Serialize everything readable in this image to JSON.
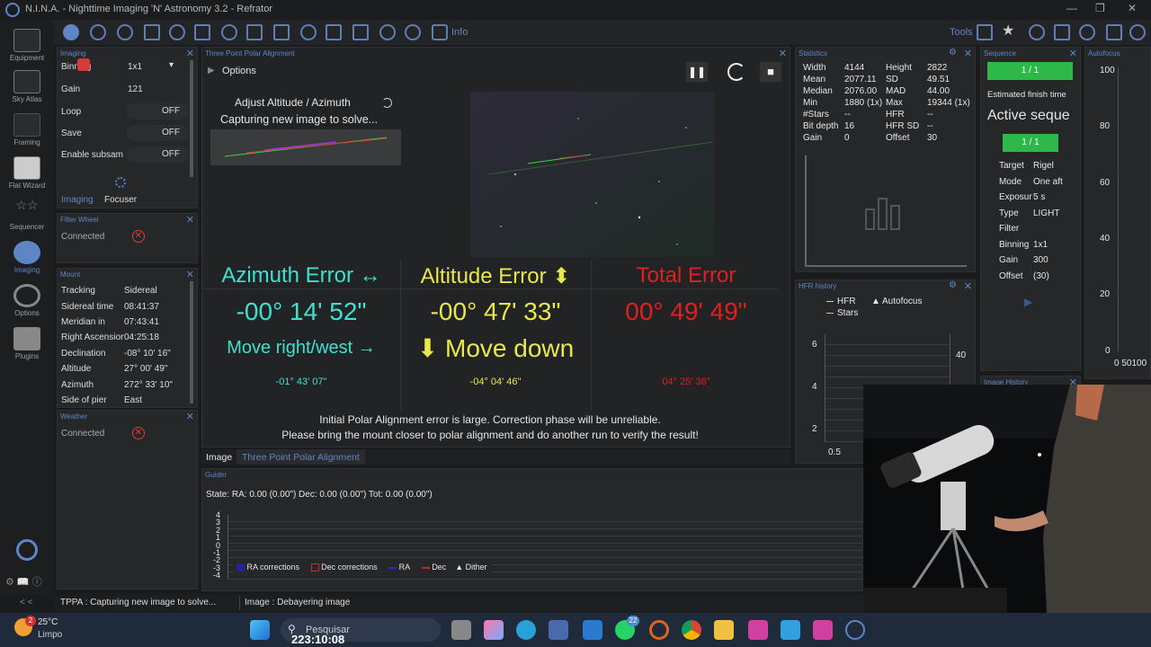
{
  "window": {
    "title": "N.I.N.A. - Nighttime Imaging 'N' Astronomy 3.2 - Refrator",
    "minimize": "—",
    "restore": "❐",
    "close": "✕"
  },
  "sidebar": {
    "items": [
      {
        "label": "Equipment"
      },
      {
        "label": "Sky Atlas"
      },
      {
        "label": "Framing"
      },
      {
        "label": "Flat Wizard"
      },
      {
        "label": "Sequencer"
      },
      {
        "label": "Imaging"
      },
      {
        "label": "Options"
      },
      {
        "label": "Plugins"
      }
    ],
    "collapse": "< <"
  },
  "toolbar": {
    "info": "Info",
    "tools": "Tools"
  },
  "imaging_panel": {
    "header": "Imaging",
    "binning_label": "Binning",
    "binning_value": "1x1",
    "gain_label": "Gain",
    "gain_value": "121",
    "loop_label": "Loop",
    "loop_value": "OFF",
    "save_label": "Save",
    "save_value": "OFF",
    "subsample_label": "Enable subsam",
    "subsample_value": "OFF",
    "tab_imaging": "Imaging",
    "tab_focuser": "Focuser"
  },
  "filterwheel": {
    "header": "Filter Wheel",
    "connected": "Connected"
  },
  "mount": {
    "header": "Mount",
    "rows": [
      {
        "label": "Tracking",
        "value": "Sidereal"
      },
      {
        "label": "Sidereal time",
        "value": "08:41:37"
      },
      {
        "label": "Meridian in",
        "value": "07:43:41"
      },
      {
        "label": "Right Ascension",
        "value": "04:25:18"
      },
      {
        "label": "Declination",
        "value": "-08° 10' 16\""
      },
      {
        "label": "Altitude",
        "value": "27° 00' 49\""
      },
      {
        "label": "Azimuth",
        "value": "272° 33' 10\""
      },
      {
        "label": "Side of pier",
        "value": "East"
      }
    ]
  },
  "weather": {
    "header": "Weather",
    "connected": "Connected"
  },
  "tppa": {
    "header": "Three Point Polar Alignment",
    "options": "Options",
    "adjust": "Adjust Altitude / Azimuth",
    "capturing": "Capturing new image to solve...",
    "az_title": "Azimuth Error ↔",
    "alt_title": "Altitude Error ⬍",
    "total_title": "Total Error",
    "az_value": "-00° 14' 52\"",
    "alt_value": "-00° 47' 33\"",
    "total_value": "00° 49' 49\"",
    "az_move": "Move right/west →",
    "alt_move": "⬇ Move down",
    "az_small": "-01° 43' 07\"",
    "alt_small": "-04° 04' 46\"",
    "total_small": "04° 25' 36\"",
    "warning1": "Initial Polar Alignment error is large. Correction phase will be unreliable.",
    "warning2": "Please bring the mount closer to polar alignment and do another run to verify the result!",
    "tab_image": "Image",
    "tab_tppa": "Three Point Polar Alignment",
    "colors": {
      "az": "#3fe0d0",
      "alt": "#e8e84a",
      "total": "#e02020"
    }
  },
  "statistics": {
    "header": "Statistics",
    "rows": [
      [
        "Width",
        "4144",
        "Height",
        "2822"
      ],
      [
        "Mean",
        "2077.11",
        "SD",
        "49.51"
      ],
      [
        "Median",
        "2076.00",
        "MAD",
        "44.00"
      ],
      [
        "Min",
        "1880 (1x)",
        "Max",
        "19344 (1x)"
      ],
      [
        "#Stars",
        "--",
        "HFR",
        "--"
      ],
      [
        "Bit depth",
        "16",
        "HFR SD",
        "--"
      ],
      [
        "Gain",
        "0",
        "Offset",
        "30"
      ]
    ]
  },
  "hfr": {
    "header": "HFR history",
    "legend_hfr": "HFR",
    "legend_af": "Autofocus",
    "legend_stars": "Stars",
    "y_ticks": [
      "6",
      "4",
      "2"
    ],
    "y_right": "40",
    "x_tick": "0.5"
  },
  "sequence": {
    "header": "Sequence",
    "progress1": "1 / 1",
    "estimated": "Estimated finish time",
    "active": "Active seque",
    "progress2": "1 / 1",
    "rows": [
      {
        "label": "Target",
        "value": "Rigel"
      },
      {
        "label": "Mode",
        "value": "One aft"
      },
      {
        "label": "Exposur",
        "value": "5 s"
      },
      {
        "label": "Type",
        "value": "LIGHT"
      },
      {
        "label": "Filter",
        "value": ""
      },
      {
        "label": "Binning",
        "value": "1x1"
      },
      {
        "label": "Gain",
        "value": "300"
      },
      {
        "label": "Offset",
        "value": "(30)"
      }
    ],
    "history": "Image History"
  },
  "autofocus": {
    "header": "Autofocus",
    "ticks": [
      "100",
      "80",
      "60",
      "40",
      "20",
      "0"
    ],
    "x": "0 50100"
  },
  "guider": {
    "header": "Guider",
    "state": "State:  RA: 0.00 (0.00\")  Dec: 0.00 (0.00\")  Tot: 0.00 (0.00\")",
    "y_ticks": [
      "4",
      "3",
      "2",
      "1",
      "0",
      "-1",
      "-2",
      "-3",
      "-4"
    ],
    "legend": [
      "RA corrections",
      "Dec corrections",
      "RA",
      "Dec",
      "Dither"
    ]
  },
  "status": {
    "tppa": "TPPA :   Capturing new image to solve...",
    "image": "Image :   Debayering image"
  },
  "taskbar": {
    "weather_temp": "25°C",
    "weather_desc": "Limpo",
    "search": "Pesquisar",
    "clock": "223:10:08",
    "badge": "2",
    "wa_badge": "22"
  }
}
